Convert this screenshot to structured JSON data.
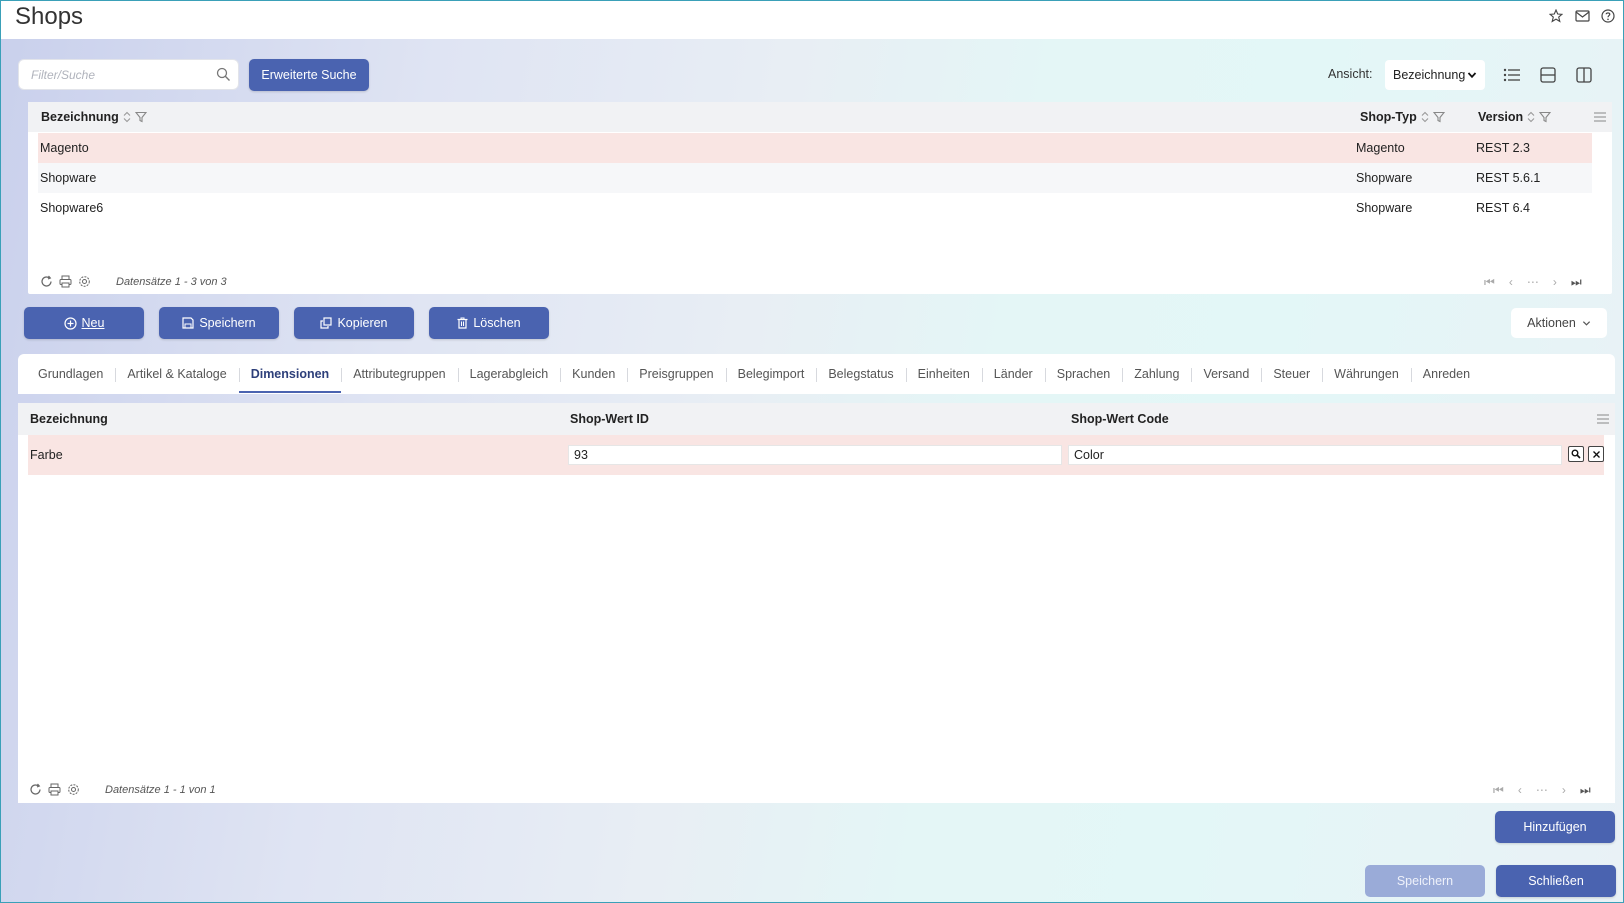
{
  "window": {
    "title": "Shops",
    "icons": [
      "star-icon",
      "mail-icon",
      "help-icon"
    ]
  },
  "search": {
    "placeholder": "Filter/Suche",
    "advanced_label": "Erweiterte Suche"
  },
  "view": {
    "label": "Ansicht:",
    "selected": "Bezeichnung",
    "icons": [
      "list-view-icon",
      "horizontal-split-icon",
      "vertical-split-icon"
    ]
  },
  "shops_grid": {
    "columns": {
      "bezeichnung": "Bezeichnung",
      "shop_typ": "Shop-Typ",
      "version": "Version"
    },
    "rows": [
      {
        "bezeichnung": "Magento",
        "shop_typ": "Magento",
        "version": "REST 2.3"
      },
      {
        "bezeichnung": "Shopware",
        "shop_typ": "Shopware",
        "version": "REST 5.6.1"
      },
      {
        "bezeichnung": "Shopware6",
        "shop_typ": "Shopware",
        "version": "REST 6.4"
      }
    ],
    "footer_info": "Datensätze 1 - 3 von 3"
  },
  "actions": {
    "neu": "Neu",
    "speichern": "Speichern",
    "kopieren": "Kopieren",
    "loeschen": "Löschen",
    "aktionen": "Aktionen"
  },
  "tabs": [
    {
      "label": "Grundlagen"
    },
    {
      "label": "Artikel & Kataloge"
    },
    {
      "label": "Dimensionen"
    },
    {
      "label": "Attributegruppen"
    },
    {
      "label": "Lagerabgleich"
    },
    {
      "label": "Kunden"
    },
    {
      "label": "Preisgruppen"
    },
    {
      "label": "Belegimport"
    },
    {
      "label": "Belegstatus"
    },
    {
      "label": "Einheiten"
    },
    {
      "label": "Länder"
    },
    {
      "label": "Sprachen"
    },
    {
      "label": "Zahlung"
    },
    {
      "label": "Versand"
    },
    {
      "label": "Steuer"
    },
    {
      "label": "Währungen"
    },
    {
      "label": "Anreden"
    }
  ],
  "active_tab": "Dimensionen",
  "dimensions_grid": {
    "columns": {
      "bezeichnung": "Bezeichnung",
      "shop_wert_id": "Shop-Wert ID",
      "shop_wert_code": "Shop-Wert Code"
    },
    "rows": [
      {
        "bezeichnung": "Farbe",
        "shop_wert_id": "93",
        "shop_wert_code": "Color"
      }
    ],
    "footer_info": "Datensätze 1 - 1 von 1"
  },
  "bottom": {
    "hinzufuegen": "Hinzufügen",
    "speichern": "Speichern",
    "schliessen": "Schließen"
  },
  "colors": {
    "primary": "#4a63b0",
    "selected_row": "#f9e5e3",
    "disabled_button": "#9aabd8"
  }
}
